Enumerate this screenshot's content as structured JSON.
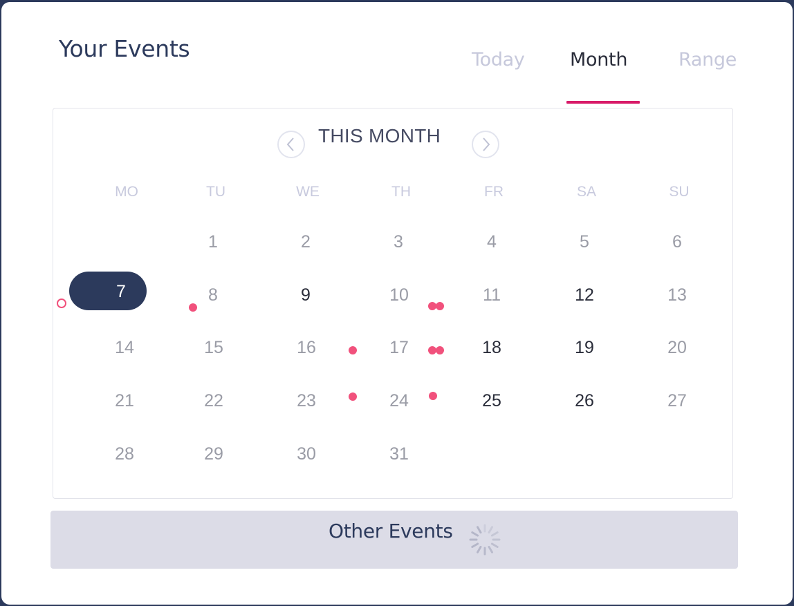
{
  "header": {
    "title": "Your Events",
    "tabs": [
      {
        "label": "Today",
        "active": false
      },
      {
        "label": "Month",
        "active": true
      },
      {
        "label": "Range",
        "active": false
      }
    ]
  },
  "calendar": {
    "month_label": "THIS MONTH",
    "prev_icon": "chevron-left-icon",
    "next_icon": "chevron-right-icon",
    "weekdays": [
      "MO",
      "TU",
      "WE",
      "TH",
      "FR",
      "SA",
      "SU"
    ],
    "days": [
      "1",
      "2",
      "3",
      "4",
      "5",
      "6",
      "7",
      "8",
      "9",
      "10",
      "11",
      "12",
      "13",
      "14",
      "15",
      "16",
      "17",
      "18",
      "19",
      "20",
      "21",
      "22",
      "23",
      "24",
      "25",
      "26",
      "27",
      "28",
      "29",
      "30",
      "31"
    ],
    "selected_day": "7",
    "colors": {
      "accent": "#d81b69",
      "selected": "#2c3a5c",
      "event_dot": "#f1517c"
    }
  },
  "footer": {
    "other_events_label": "Other Events",
    "spinner_icon": "loading-spinner-icon"
  }
}
